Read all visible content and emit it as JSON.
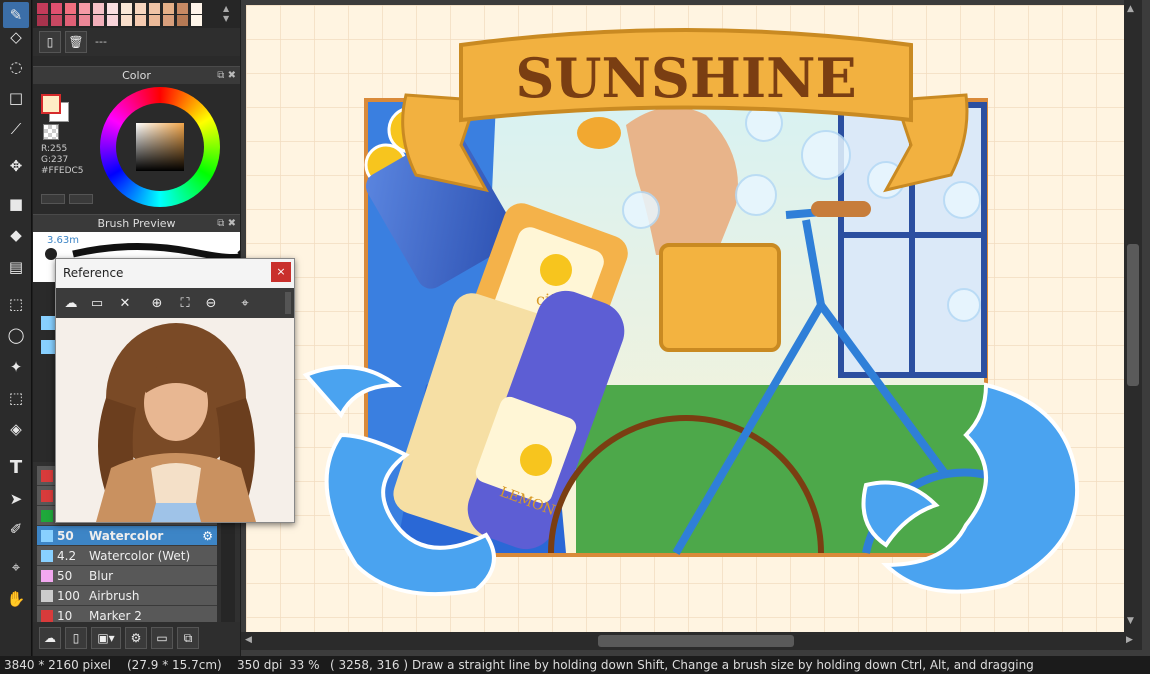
{
  "panels": {
    "color": {
      "title": "Color",
      "r": "R:255",
      "g": "G:237",
      "hex": "#FFEDC5",
      "fg": "#FFEDC5",
      "bg": "#FFFFFF"
    },
    "brush_preview": {
      "title": "Brush Preview",
      "size": "3.63m"
    },
    "palette_label": "---"
  },
  "palette_colors": [
    "#c53b5a",
    "#e0506f",
    "#f26f7f",
    "#f59aa6",
    "#f6c1c7",
    "#fbe0e2",
    "#fae8d8",
    "#f8d7c0",
    "#f0c4a6",
    "#e5b088",
    "#c88a64",
    "#fef3e9",
    "#a8334d",
    "#c94862",
    "#e06076",
    "#ec8797",
    "#f2afba",
    "#f8d4da",
    "#f9dfcc",
    "#f5cbb1",
    "#ebb998",
    "#d89f7c",
    "#b67a55",
    "#fff6ea"
  ],
  "brushes": [
    {
      "swatch": "#d83b3b",
      "num": "",
      "name": ""
    },
    {
      "swatch": "#d83b3b",
      "num": "",
      "name": ""
    },
    {
      "swatch": "#1fa83b",
      "num": "",
      "name": ""
    },
    {
      "swatch": "#88d0ff",
      "num": "50",
      "name": "Watercolor"
    },
    {
      "swatch": "#88d0ff",
      "num": "4.2",
      "name": "Watercolor (Wet)"
    },
    {
      "swatch": "#f2a8f0",
      "num": "50",
      "name": "Blur"
    },
    {
      "swatch": "#cccccc",
      "num": "100",
      "name": "Airbrush"
    },
    {
      "swatch": "#d83b3b",
      "num": "10",
      "name": "Marker 2"
    }
  ],
  "reference": {
    "title": "Reference",
    "close": "×"
  },
  "artwork": {
    "banner_text": "SUNSHINE",
    "label_citron": "citron",
    "label_lemon": "LEMON"
  },
  "status": {
    "size": "3840 * 2160 pixel",
    "cm": "(27.9 * 15.7cm)",
    "dpi": "350 dpi",
    "zoom": "33 %",
    "coords": "( 3258, 316 )",
    "hint": "Draw a straight line by holding down Shift, Change a brush size by holding down Ctrl, Alt, and dragging"
  },
  "colors": {
    "accent": "#3d85c6",
    "canvas_bg": "#fff4e1",
    "banner": "#f2b140",
    "brown": "#7a3e12"
  }
}
